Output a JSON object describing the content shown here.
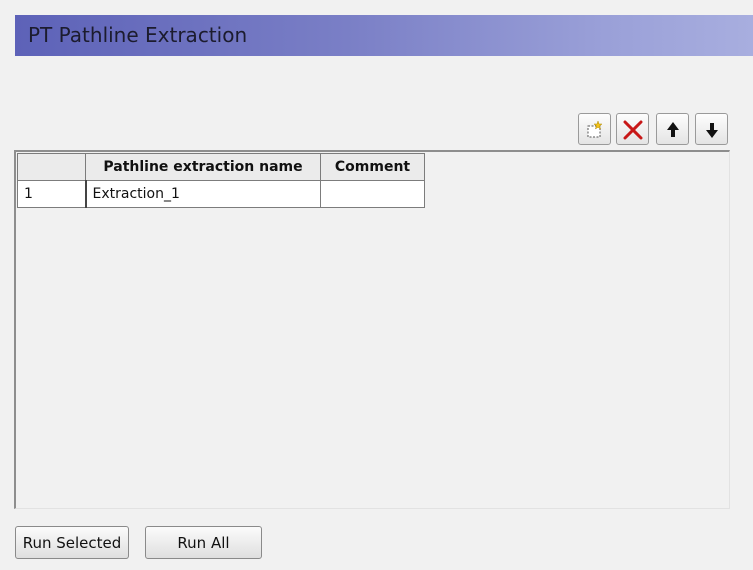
{
  "window": {
    "title": "PT Pathline Extraction"
  },
  "toolbar": {
    "buttons": [
      {
        "name": "add-row",
        "icon": "new-item-icon"
      },
      {
        "name": "delete-row",
        "icon": "delete-x-icon",
        "color": "#c81818"
      },
      {
        "name": "move-up",
        "icon": "arrow-up-icon"
      },
      {
        "name": "move-down",
        "icon": "arrow-down-icon"
      }
    ]
  },
  "table": {
    "columns": [
      "",
      "Pathline extraction name",
      "Comment"
    ],
    "rows": [
      {
        "index": "1",
        "name": "Extraction_1",
        "comment": ""
      }
    ]
  },
  "footer": {
    "run_selected_label": "Run Selected",
    "run_all_label": "Run All"
  }
}
